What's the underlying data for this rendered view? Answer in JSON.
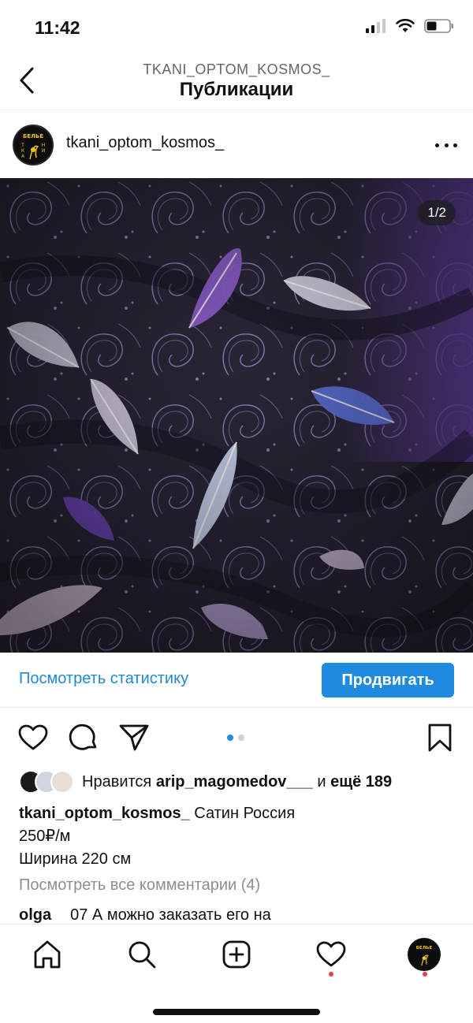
{
  "status": {
    "time": "11:42"
  },
  "header": {
    "username": "TKANI_OPTOM_KOSMOS_",
    "title": "Публикации"
  },
  "post": {
    "username": "tkani_optom_kosmos_",
    "avatar_text": [
      "БЕЛЬЕ",
      "Т",
      "К",
      "А",
      "Н",
      "И"
    ],
    "image_counter": "1/2",
    "carousel": {
      "count": 2,
      "active": 1
    }
  },
  "promo": {
    "stats_link": "Посмотреть статистику",
    "promote_button": "Продвигать"
  },
  "likes": {
    "prefix": "Нравится",
    "user": "arip_magomedov___",
    "conj": "и",
    "more": "ещё 189"
  },
  "caption": {
    "username": "tkani_optom_kosmos_",
    "lines": [
      "Сатин Россия",
      "250₽/м",
      "Ширина 220 см"
    ]
  },
  "comments": {
    "view_all": "Посмотреть все комментарии (4)",
    "first": {
      "user": "olga",
      "text": "07 А можно заказать его на"
    }
  },
  "colors": {
    "accent": "#1f8bdf",
    "link": "#1e88d6",
    "notification": "#ef3b4a"
  },
  "icons": {
    "back": "chevron-left-icon",
    "more": "more-horizontal-icon",
    "like": "heart-icon",
    "comment": "comment-icon",
    "share": "send-icon",
    "save": "bookmark-icon",
    "home": "home-icon",
    "search": "search-icon",
    "create": "plus-square-icon",
    "activity": "heart-icon"
  }
}
